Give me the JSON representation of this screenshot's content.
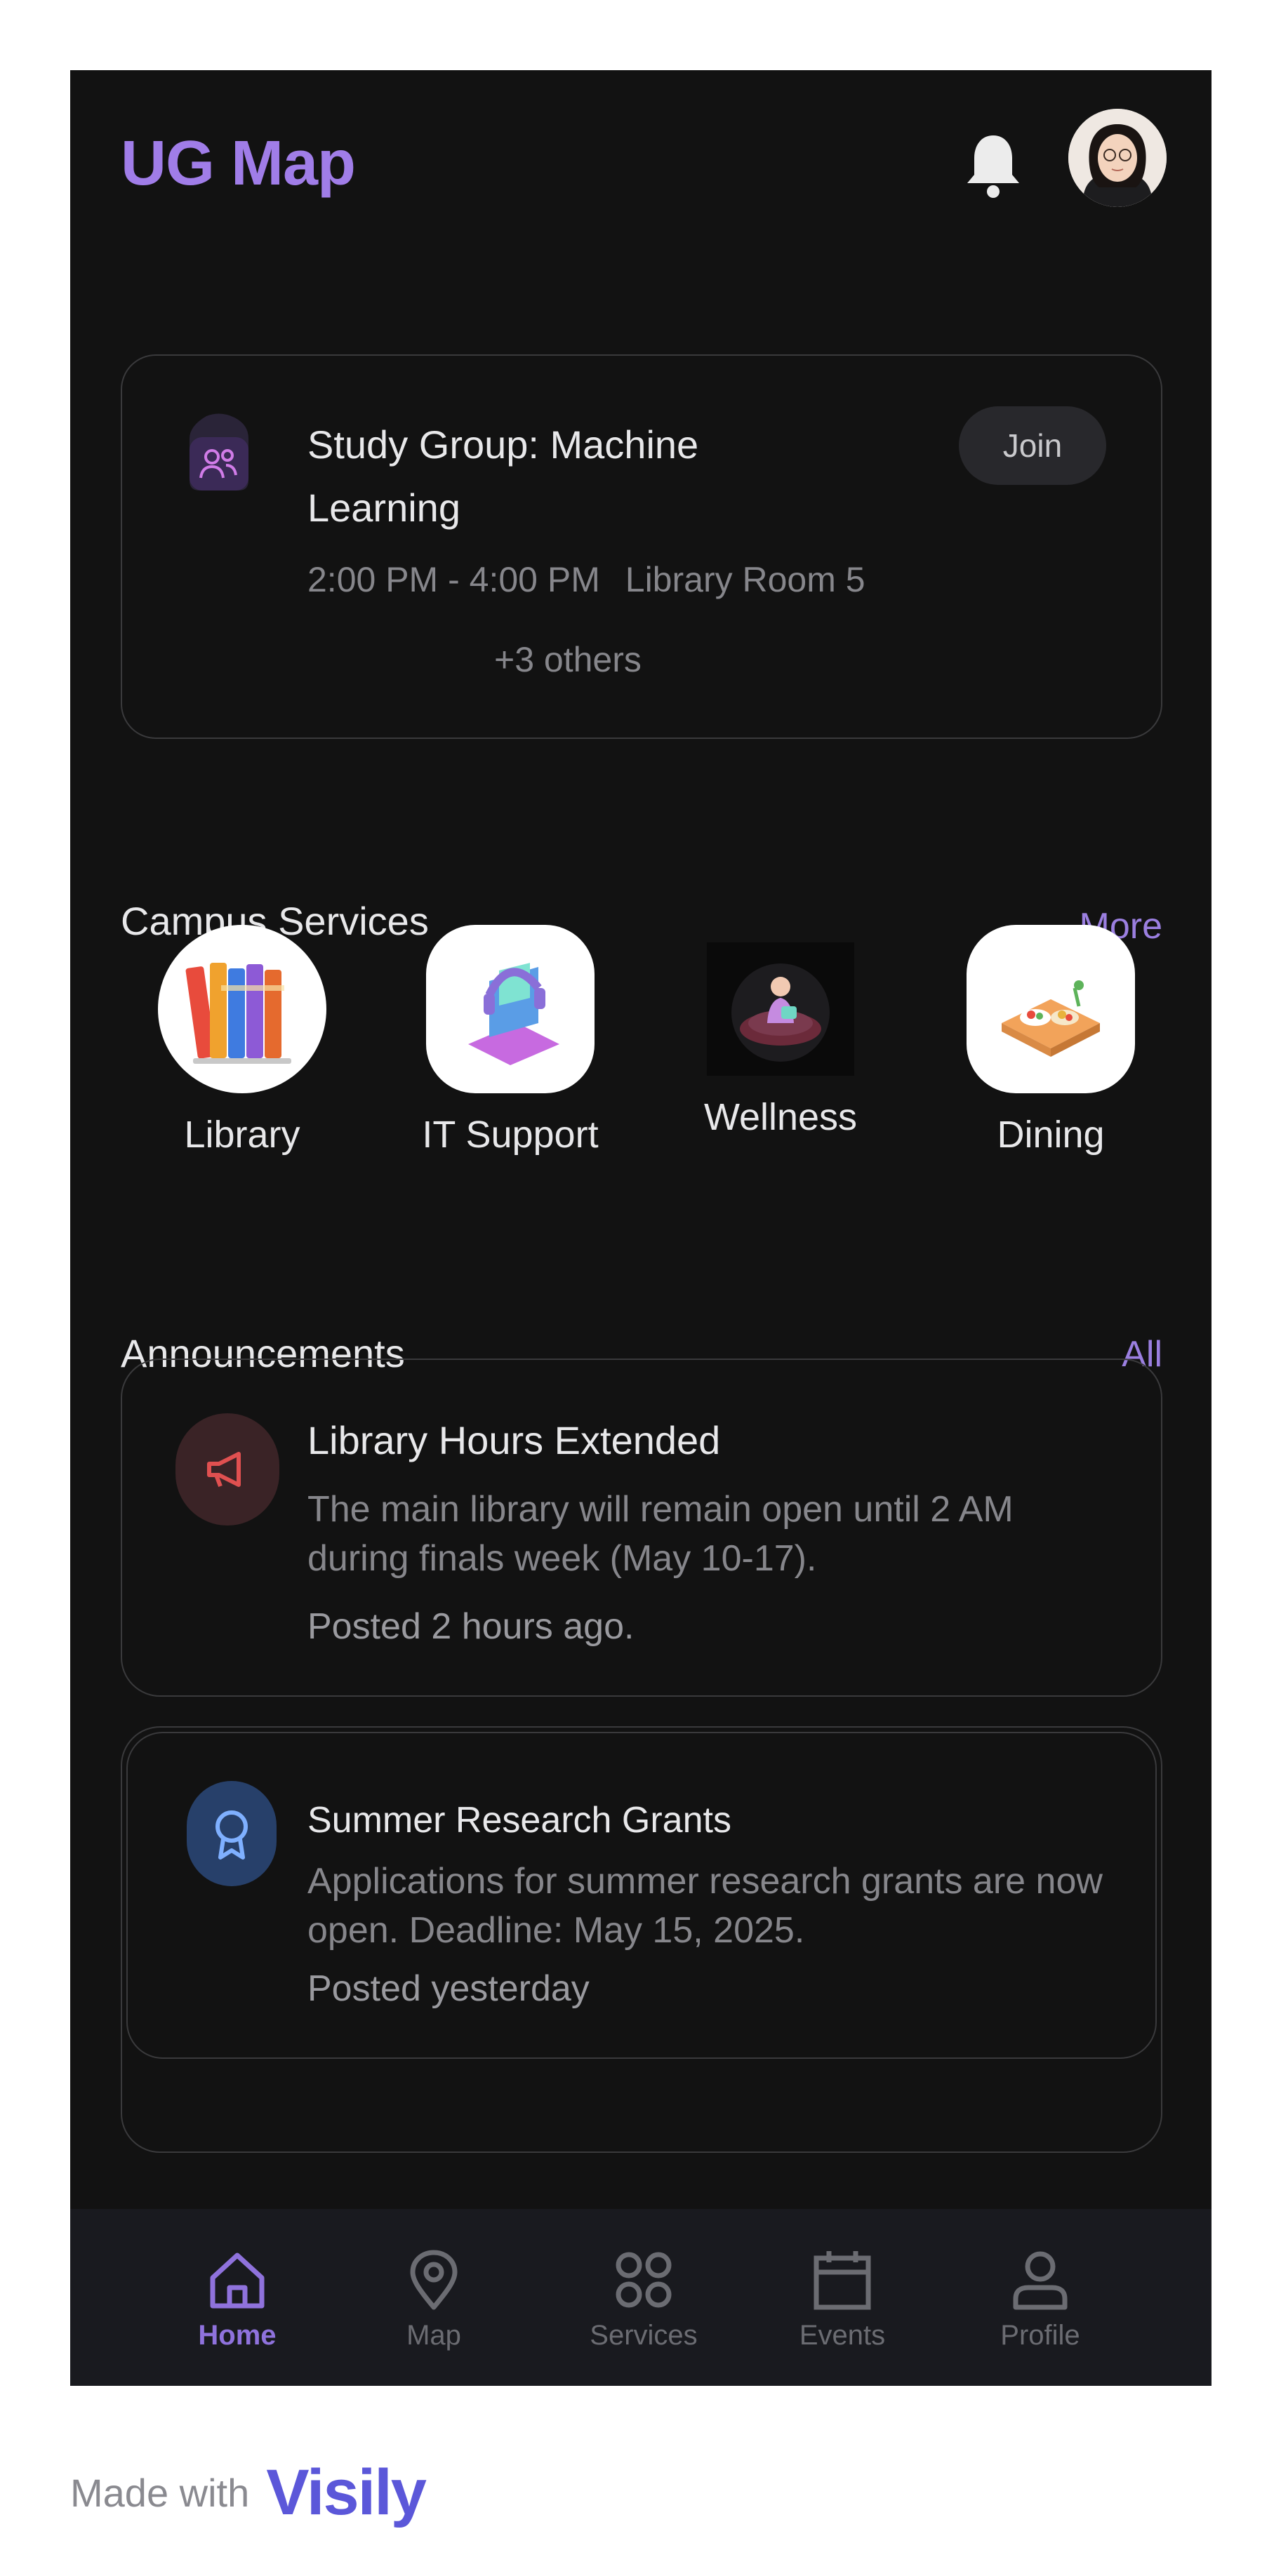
{
  "header": {
    "app_title": "UG Map"
  },
  "event": {
    "title": "Study Group: Machine Learning",
    "time": "2:00 PM - 4:00 PM",
    "location": "Library Room 5",
    "attendees": "+3 others",
    "join_label": "Join"
  },
  "services": {
    "section_title": "Campus Services",
    "more_label": "More",
    "items": [
      {
        "label": "Library",
        "icon": "books-icon"
      },
      {
        "label": "IT Support",
        "icon": "headset-laptop-icon"
      },
      {
        "label": "Wellness",
        "icon": "wellness-icon"
      },
      {
        "label": "Dining",
        "icon": "food-tray-icon"
      }
    ]
  },
  "announcements": {
    "section_title": "Announcements",
    "all_label": "All",
    "items": [
      {
        "title": "Library Hours Extended",
        "body": "The main library will remain open until 2 AM during finals week (May 10-17).",
        "posted": "Posted 2 hours ago.",
        "icon": "megaphone-icon"
      },
      {
        "title": "Summer Research Grants",
        "body": "Applications for summer research grants are now open. Deadline: May 15, 2025.",
        "posted": "Posted yesterday",
        "icon": "award-icon"
      }
    ]
  },
  "nav": {
    "items": [
      {
        "label": "Home",
        "icon": "home-icon",
        "active": true
      },
      {
        "label": "Map",
        "icon": "map-pin-icon",
        "active": false
      },
      {
        "label": "Services",
        "icon": "grid-icon",
        "active": false
      },
      {
        "label": "Events",
        "icon": "calendar-icon",
        "active": false
      },
      {
        "label": "Profile",
        "icon": "user-icon",
        "active": false
      }
    ]
  },
  "footer": {
    "made_with": "Made with",
    "brand": "Visily"
  },
  "colors": {
    "accent": "#a07de8",
    "background": "#121212",
    "nav_background": "#191a1f"
  }
}
